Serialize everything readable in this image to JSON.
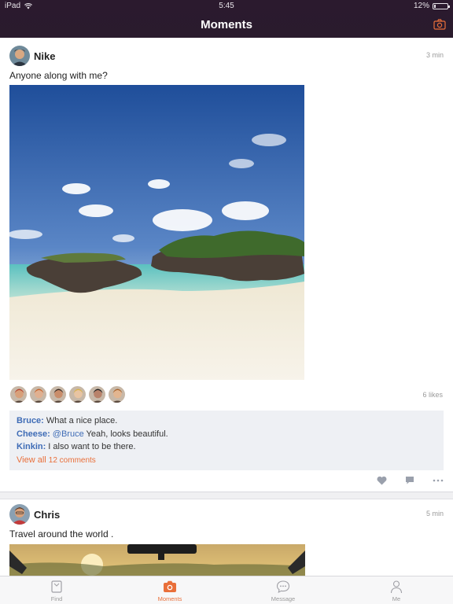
{
  "status_bar": {
    "device": "iPad",
    "time": "5:45",
    "battery": "12%",
    "battery_level": 0.12
  },
  "nav": {
    "title": "Moments",
    "camera_icon": "camera-icon"
  },
  "posts": [
    {
      "author": "Nike",
      "time": "3 min",
      "caption": "Anyone along with me?",
      "likes": "6 likes",
      "likers_count": 6,
      "comments": [
        {
          "author": "Bruce:",
          "mention": "",
          "text": "What a nice place."
        },
        {
          "author": "Cheese:",
          "mention": "@Bruce",
          "text": " Yeah, looks beautiful."
        },
        {
          "author": "Kinkin:",
          "mention": "",
          "text": "I also want to be there."
        }
      ],
      "view_all_label": "View all",
      "view_all_count": "12 comments",
      "actions": [
        "heart-icon",
        "comment-icon",
        "more-icon"
      ]
    },
    {
      "author": "Chris",
      "time": "5 min",
      "caption": "Travel around the world ."
    }
  ],
  "tabs": [
    {
      "label": "Find",
      "icon": "find-icon",
      "active": false
    },
    {
      "label": "Moments",
      "icon": "camera-icon",
      "active": true
    },
    {
      "label": "Message",
      "icon": "message-icon",
      "active": false
    },
    {
      "label": "Me",
      "icon": "person-icon",
      "active": false
    }
  ],
  "colors": {
    "accent": "#e96f3a",
    "link": "#3f6cb6",
    "nav_bg": "#2b1a2e"
  }
}
